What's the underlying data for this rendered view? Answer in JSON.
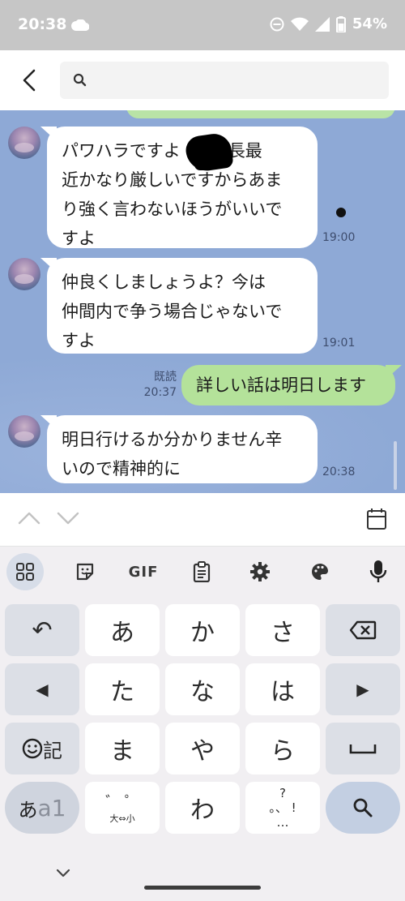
{
  "status": {
    "time": "20:38",
    "battery": "54%"
  },
  "header": {
    "search_placeholder": ""
  },
  "chat": {
    "messages": [
      {
        "side": "left",
        "text_lines": [
          "パワハラですよ",
          "部長最",
          "近かなり厳しいですからあま",
          "り強く言わないほうがいいで",
          "すよ"
        ],
        "time": "19:00"
      },
      {
        "side": "left",
        "text_lines": [
          "仲良くしましょうよ？今は",
          "仲間内で争う場合じゃないで",
          "すよ"
        ],
        "time": "19:01"
      },
      {
        "side": "right",
        "text": "詳しい話は明日します",
        "read": "既読",
        "time": "20:37"
      },
      {
        "side": "left",
        "text_lines": [
          "明日行けるか分かりません辛",
          "いので精神的に"
        ],
        "time": "20:38"
      }
    ]
  },
  "keyboard": {
    "tools": [
      "apps-icon",
      "sticker-icon",
      "GIF",
      "clipboard-icon",
      "settings-icon",
      "palette-icon",
      "mic-icon"
    ],
    "gif_label": "GIF",
    "rows": {
      "r1": {
        "undo": "↶",
        "k1": "あ",
        "k2": "か",
        "k3": "さ"
      },
      "r2": {
        "left": "◀",
        "k1": "た",
        "k2": "な",
        "k3": "は",
        "right": "▶"
      },
      "r3": {
        "emoji_label": "記",
        "k1": "ま",
        "k2": "や",
        "k3": "ら",
        "space": "⎵"
      },
      "r4": {
        "mode_a": "あ",
        "mode_b": "a1",
        "small_top": "゛ ゜",
        "small_bottom": "大⇔小",
        "k1": "わ",
        "punct_top": "?",
        "punct_mid": "。、 !",
        "punct_bottom": "…"
      }
    }
  }
}
